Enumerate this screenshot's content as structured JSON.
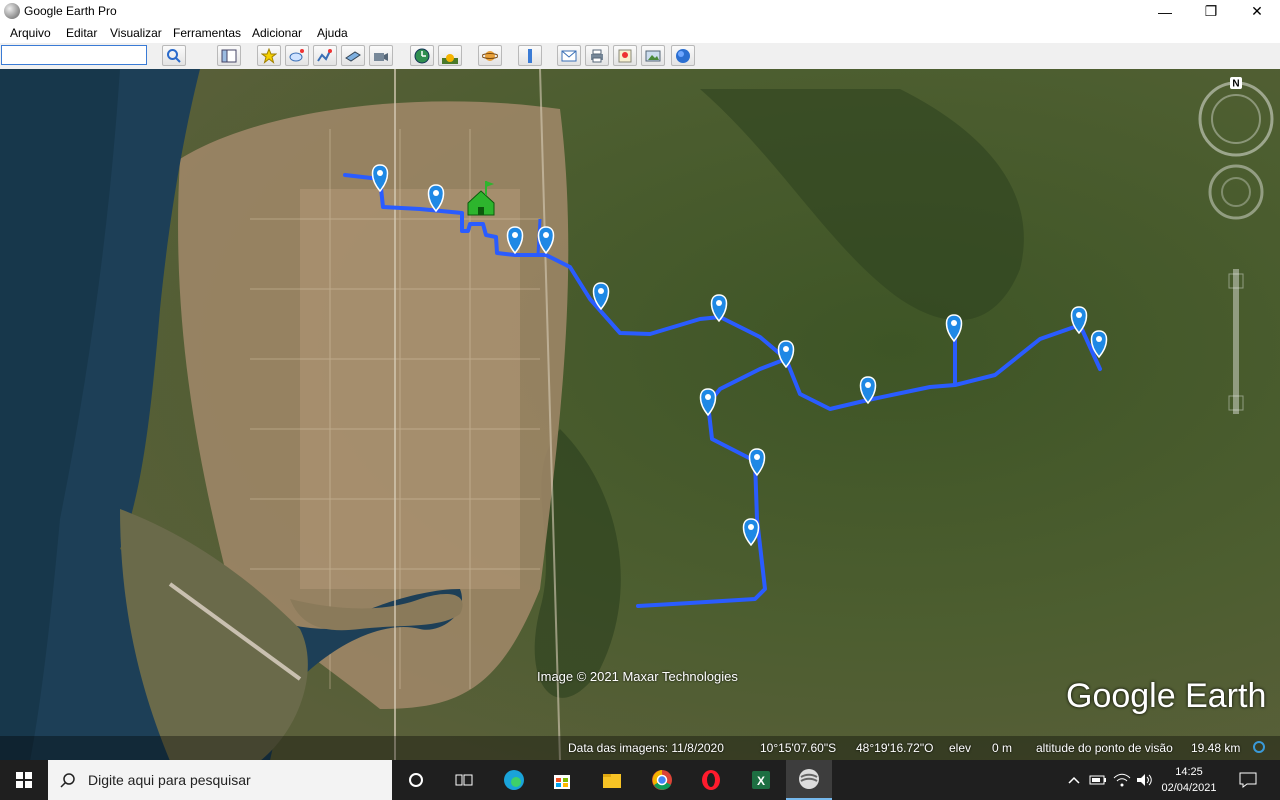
{
  "window": {
    "title": "Google Earth Pro",
    "minimize": "—",
    "maximize": "❐",
    "close": "✕"
  },
  "menu": [
    "Arquivo",
    "Editar",
    "Visualizar",
    "Ferramentas",
    "Adicionar",
    "Ajuda"
  ],
  "search": {
    "value": ""
  },
  "map": {
    "credit": "Image © 2021 Maxar Technologies",
    "logo": "Google Earth",
    "compass_label": "N",
    "status": {
      "date_label": "Data das imagens: 11/8/2020",
      "lat": "10°15'07.60\"S",
      "lon": "48°19'16.72\"O",
      "elev_label": "elev",
      "elev_value": "0 m",
      "altitude_label": "altitude do ponto de visão",
      "altitude_value": "19.48 km"
    }
  },
  "taskbar": {
    "search_placeholder": "Digite aqui para pesquisar",
    "time": "14:25",
    "date": "02/04/2021"
  },
  "colors": {
    "route": "#2a5cff",
    "pin": "#1e88e5",
    "water": "#1c3d52",
    "land": "#4a5a2e",
    "house": "#2db52d"
  }
}
